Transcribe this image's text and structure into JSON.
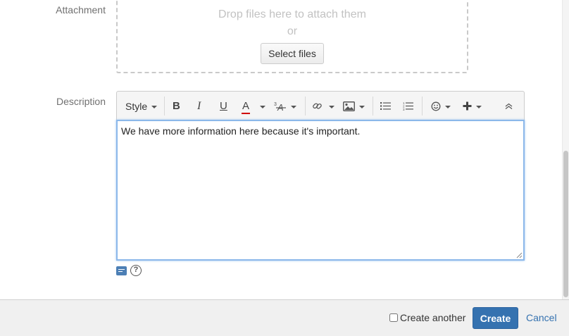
{
  "attachment": {
    "label": "Attachment",
    "drop_text": "Drop files here to attach them",
    "or_text": "or",
    "select_label": "Select files"
  },
  "description": {
    "label": "Description",
    "text": "We have more information here because it's important."
  },
  "toolbar": {
    "style_label": "Style",
    "bold": "B",
    "italic": "I",
    "underline": "U",
    "text_color": "A",
    "text_color_swatch": "#d00000",
    "icons": [
      "bold-icon",
      "italic-icon",
      "underline-icon",
      "text-color-icon",
      "text-format-icon",
      "link-icon",
      "image-icon",
      "bullet-list-icon",
      "numbered-list-icon",
      "emoticon-icon",
      "insert-plus-icon",
      "collapse-icon"
    ]
  },
  "footer": {
    "create_another_label": "Create another",
    "create_label": "Create",
    "cancel_label": "Cancel"
  },
  "colors": {
    "primary": "#3572b0",
    "focus_border": "#8cb8ea"
  }
}
